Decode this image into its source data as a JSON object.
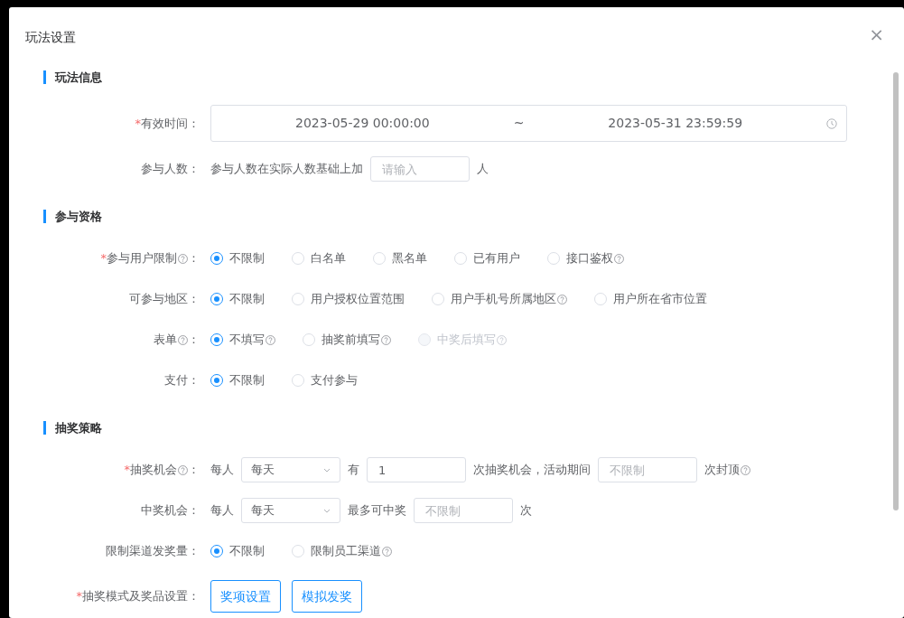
{
  "dialog": {
    "title": "玩法设置",
    "close": "×"
  },
  "sections": [
    {
      "title": "玩法信息",
      "rows": [
        {
          "kind": "daterange",
          "label": "有效时间",
          "colon": "：",
          "required_mark": "*",
          "help": false,
          "start": "2023-05-29 00:00:00",
          "separator": "~",
          "end": "2023-05-31 23:59:59"
        },
        {
          "kind": "inline",
          "label": "参与人数",
          "colon": "：",
          "help": false,
          "parts": [
            {
              "kind": "text",
              "text": "参与人数在实际人数基础上加"
            },
            {
              "kind": "input",
              "placeholder": "请输入"
            },
            {
              "kind": "text",
              "text": "人"
            }
          ]
        }
      ]
    },
    {
      "title": "参与资格",
      "rows": [
        {
          "kind": "radio",
          "label": "参与用户限制",
          "colon": "：",
          "required_mark": "*",
          "help": true,
          "options": [
            {
              "label": "不限制",
              "selected": true,
              "disabled": false,
              "help": false
            },
            {
              "label": "白名单",
              "selected": false,
              "disabled": false,
              "help": false
            },
            {
              "label": "黑名单",
              "selected": false,
              "disabled": false,
              "help": false
            },
            {
              "label": "已有用户",
              "selected": false,
              "disabled": false,
              "help": false
            },
            {
              "label": "接口鉴权",
              "selected": false,
              "disabled": false,
              "help": true
            }
          ]
        },
        {
          "kind": "radio",
          "label": "可参与地区",
          "colon": "：",
          "help": false,
          "options": [
            {
              "label": "不限制",
              "selected": true,
              "disabled": false,
              "help": false
            },
            {
              "label": "用户授权位置范围",
              "selected": false,
              "disabled": false,
              "help": false
            },
            {
              "label": "用户手机号所属地区",
              "selected": false,
              "disabled": false,
              "help": true
            },
            {
              "label": "用户所在省市位置",
              "selected": false,
              "disabled": false,
              "help": false
            }
          ]
        },
        {
          "kind": "radio",
          "label": "表单",
          "colon": "：",
          "help": true,
          "options": [
            {
              "label": "不填写",
              "selected": true,
              "disabled": false,
              "help": true
            },
            {
              "label": "抽奖前填写",
              "selected": false,
              "disabled": false,
              "help": true
            },
            {
              "label": "中奖后填写",
              "selected": false,
              "disabled": true,
              "help": true
            }
          ]
        },
        {
          "kind": "radio",
          "label": "支付",
          "colon": "：",
          "help": false,
          "options": [
            {
              "label": "不限制",
              "selected": true,
              "disabled": false,
              "help": false
            },
            {
              "label": "支付参与",
              "selected": false,
              "disabled": false,
              "help": false
            }
          ]
        }
      ]
    },
    {
      "title": "抽奖策略",
      "rows": [
        {
          "kind": "inline",
          "label": "抽奖机会",
          "colon": "：",
          "required_mark": "*",
          "help": true,
          "parts": [
            {
              "kind": "text",
              "text": "每人"
            },
            {
              "kind": "select",
              "value": "每天"
            },
            {
              "kind": "text",
              "text": "有"
            },
            {
              "kind": "input",
              "value": "1"
            },
            {
              "kind": "text",
              "text": "次抽奖机会，活动期间"
            },
            {
              "kind": "input",
              "placeholder": "不限制"
            },
            {
              "kind": "text",
              "text": "次封顶",
              "help": true
            }
          ]
        },
        {
          "kind": "inline",
          "label": "中奖机会",
          "colon": "：",
          "help": false,
          "parts": [
            {
              "kind": "text",
              "text": "每人"
            },
            {
              "kind": "select",
              "value": "每天"
            },
            {
              "kind": "text",
              "text": "最多可中奖"
            },
            {
              "kind": "input",
              "placeholder": "不限制"
            },
            {
              "kind": "text",
              "text": "次"
            }
          ]
        },
        {
          "kind": "radio",
          "label": "限制渠道发奖量",
          "colon": "：",
          "help": false,
          "options": [
            {
              "label": "不限制",
              "selected": true,
              "disabled": false,
              "help": false
            },
            {
              "label": "限制员工渠道",
              "selected": false,
              "disabled": false,
              "help": true
            }
          ]
        },
        {
          "kind": "buttons",
          "label": "抽奖模式及奖品设置",
          "colon": "：",
          "required_mark": "*",
          "help": false,
          "buttons": [
            "奖项设置",
            "模拟发奖"
          ]
        }
      ]
    }
  ]
}
